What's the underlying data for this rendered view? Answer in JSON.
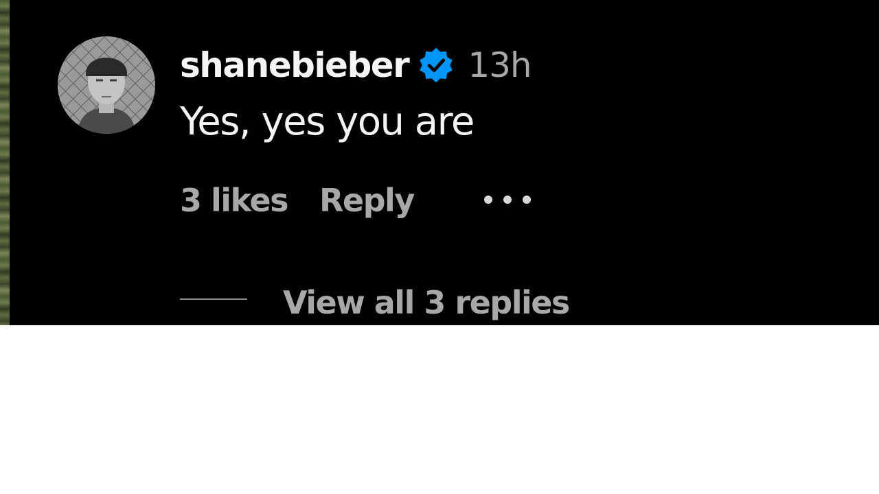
{
  "comment": {
    "username": "shanebieber",
    "verified": true,
    "timestamp": "13h",
    "text": "Yes, yes you are",
    "likes_label": "3 likes",
    "reply_label": "Reply",
    "more_label": "...",
    "view_replies_label": "View all 3 replies"
  },
  "colors": {
    "background": "#000000",
    "primary_text": "#f5f5f5",
    "secondary_text": "#a8a8a8",
    "verified_badge": "#0095f6"
  },
  "icons": {
    "verified": "verified-badge-icon",
    "more": "more-options-icon",
    "avatar": "profile-avatar"
  }
}
